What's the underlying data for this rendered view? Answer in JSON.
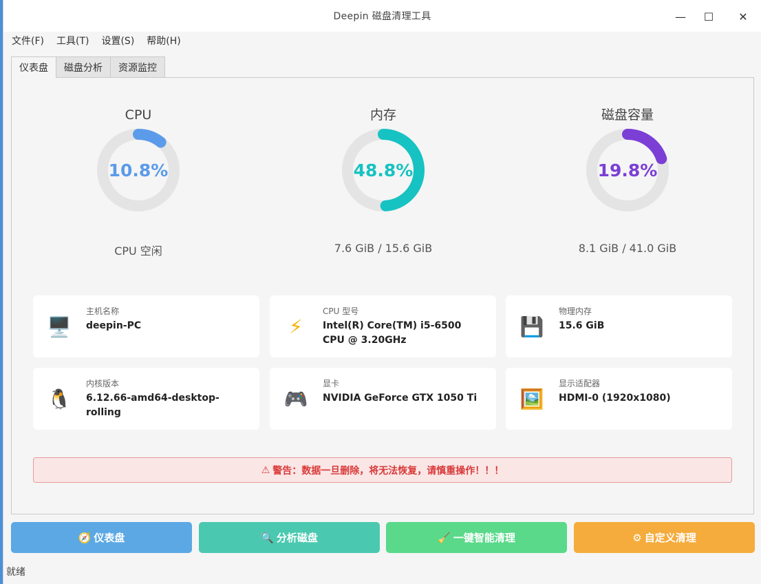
{
  "window": {
    "title": "Deepin 磁盘清理工具"
  },
  "window_controls": {
    "minimize": "—",
    "maximize": "☐",
    "close": "✕"
  },
  "menu": [
    "文件(F)",
    "工具(T)",
    "设置(S)",
    "帮助(H)"
  ],
  "tabs": [
    "仪表盘",
    "磁盘分析",
    "资源监控"
  ],
  "gauges": [
    {
      "title": "CPU",
      "value_text": "10.8%",
      "fraction": 0.108,
      "sub": "CPU 空闲",
      "color": "#5b9bea"
    },
    {
      "title": "内存",
      "value_text": "48.8%",
      "fraction": 0.488,
      "sub": "7.6 GiB / 15.6 GiB",
      "color": "#17c2c2"
    },
    {
      "title": "磁盘容量",
      "value_text": "19.8%",
      "fraction": 0.198,
      "sub": "8.1 GiB / 41.0 GiB",
      "color": "#7b3fd6"
    }
  ],
  "cards": [
    {
      "label": "主机名称",
      "value": "deepin-PC",
      "icon": "computer-icon",
      "glyph": "🖥️"
    },
    {
      "label": "CPU 型号",
      "value": "Intel(R) Core(TM) i5-6500 CPU @ 3.20GHz",
      "icon": "lightning-icon",
      "glyph": "⚡"
    },
    {
      "label": "物理内存",
      "value": "15.6 GiB",
      "icon": "floppy-disk-icon",
      "glyph": "💾"
    },
    {
      "label": "内核版本",
      "value": "6.12.66-amd64-desktop-rolling",
      "icon": "penguin-icon",
      "glyph": "🐧"
    },
    {
      "label": "显卡",
      "value": "NVIDIA GeForce GTX 1050 Ti",
      "icon": "gamepad-icon",
      "glyph": "🎮"
    },
    {
      "label": "显示适配器",
      "value": "HDMI-0 (1920x1080)",
      "icon": "framed-picture-icon",
      "glyph": "🖼️"
    }
  ],
  "warning": {
    "icon": "⚠",
    "text": "警告：数据一旦删除，将无法恢复，请慎重操作！！！"
  },
  "actions": [
    {
      "label": "仪表盘",
      "glyph": "🧭",
      "icon": "dashboard-icon",
      "color": "#5ba8e4"
    },
    {
      "label": "分析磁盘",
      "glyph": "🔍",
      "icon": "analyze-icon",
      "color": "#4bc9b0"
    },
    {
      "label": "一键智能清理",
      "glyph": "🧹",
      "icon": "broom-icon",
      "color": "#5ad98a"
    },
    {
      "label": "自定义清理",
      "glyph": "⚙",
      "icon": "gear-icon",
      "color": "#f5ac3c"
    }
  ],
  "status": "就绪"
}
